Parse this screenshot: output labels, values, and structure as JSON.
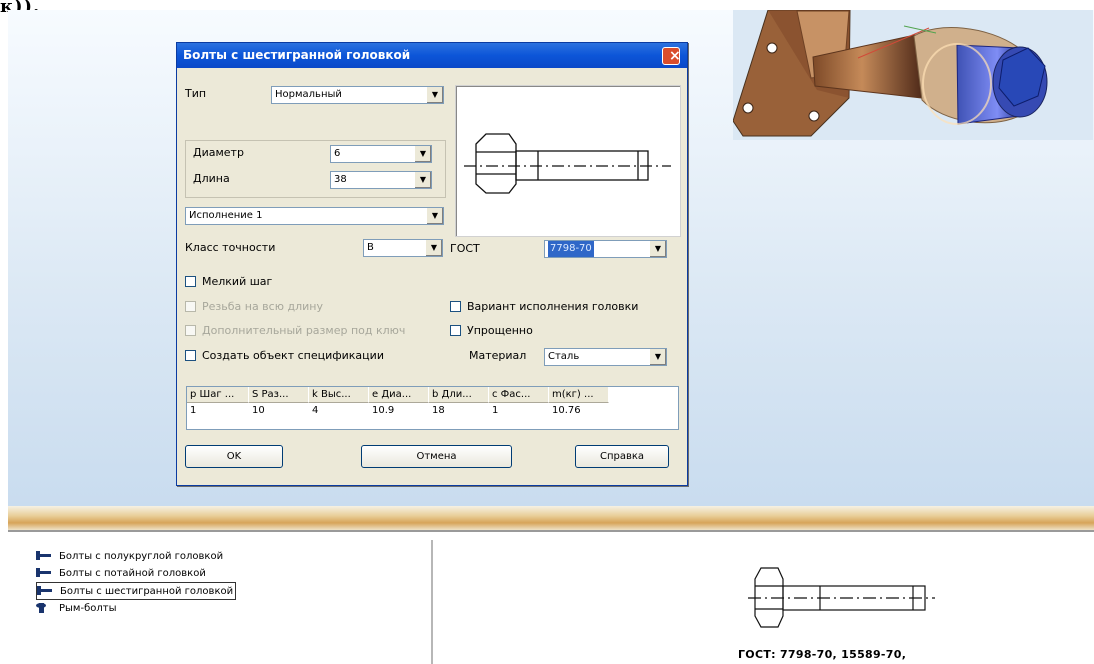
{
  "page": {
    "heading_fragment": "к)).",
    "accent": "#0a48c8",
    "workspace_color": "#dbe8f4"
  },
  "dialog": {
    "title": "Болты с шестигранной головкой",
    "type_label": "Тип",
    "type_value": "Нормальный",
    "diameter_label": "Диаметр",
    "diameter_value": "6",
    "length_label": "Длина",
    "length_value": "38",
    "variant_value": "Исполнение 1",
    "accuracy_label": "Класс точности",
    "accuracy_value": "B",
    "gost_label": "ГОСТ",
    "gost_value": "7798-70",
    "checkboxes": [
      {
        "label": "Мелкий шаг",
        "checked": false,
        "enabled": true
      },
      {
        "label": "Резьба на всю длину",
        "checked": false,
        "enabled": false
      },
      {
        "label": "Дополнительный размер под ключ",
        "checked": false,
        "enabled": false
      },
      {
        "label": "Создать объект спецификации",
        "checked": false,
        "enabled": true
      },
      {
        "label": "Вариант исполнения головки",
        "checked": false,
        "enabled": true
      },
      {
        "label": "Упрощенно",
        "checked": false,
        "enabled": true
      }
    ],
    "material_label": "Материал",
    "material_value": "Сталь",
    "table": {
      "headers": [
        "p Шаг ...",
        "S Раз...",
        "k Выс...",
        "e Диа...",
        "b Дли...",
        "c Фас...",
        "m(кг) ..."
      ],
      "rows": [
        [
          "1",
          "10",
          "4",
          "10.9",
          "18",
          "1",
          "10.76"
        ]
      ]
    },
    "buttons": {
      "ok": "OK",
      "cancel": "Отмена",
      "help": "Справка"
    }
  },
  "tree": {
    "items": [
      {
        "label": "Болты с полукруглой головкой",
        "icon": "bolt-icon",
        "selected": false
      },
      {
        "label": "Болты с потайной головкой",
        "icon": "bolt-icon",
        "selected": false
      },
      {
        "label": "Болты с шестигранной головкой",
        "icon": "bolt-icon",
        "selected": true
      },
      {
        "label": "Рым-болты",
        "icon": "eye-bolt-icon",
        "selected": false
      }
    ]
  },
  "lower_preview": {
    "caption": "ГОСТ: 7798-70, 15589-70,"
  }
}
